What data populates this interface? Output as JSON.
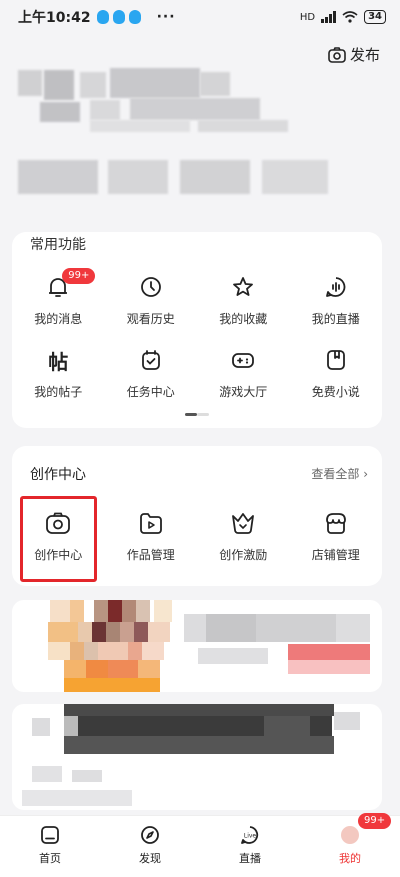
{
  "status_bar": {
    "time": "上午10:42",
    "battery": "34",
    "network": "HD"
  },
  "header": {
    "publish_label": "发布"
  },
  "common_functions": {
    "title": "常用功能",
    "items": [
      {
        "label": "我的消息",
        "icon": "bell-icon",
        "badge": "99+"
      },
      {
        "label": "观看历史",
        "icon": "clock-icon"
      },
      {
        "label": "我的收藏",
        "icon": "star-icon"
      },
      {
        "label": "我的直播",
        "icon": "live-icon"
      },
      {
        "label": "我的帖子",
        "icon": "post-icon"
      },
      {
        "label": "任务中心",
        "icon": "task-icon"
      },
      {
        "label": "游戏大厅",
        "icon": "gamepad-icon"
      },
      {
        "label": "免费小说",
        "icon": "book-icon"
      }
    ]
  },
  "creation_center": {
    "title": "创作中心",
    "view_all": "查看全部",
    "items": [
      {
        "label": "创作中心",
        "icon": "camera-icon"
      },
      {
        "label": "作品管理",
        "icon": "video-folder-icon"
      },
      {
        "label": "创作激励",
        "icon": "crown-icon"
      },
      {
        "label": "店铺管理",
        "icon": "shop-icon"
      }
    ]
  },
  "bottom_nav": {
    "items": [
      {
        "label": "首页",
        "icon": "home-icon"
      },
      {
        "label": "发现",
        "icon": "compass-icon"
      },
      {
        "label": "直播",
        "icon": "live-tv-icon"
      },
      {
        "label": "我的",
        "icon": "avatar",
        "badge": "99+"
      }
    ]
  },
  "colors": {
    "accent_red": "#f0383c",
    "highlight_box": "#e3262b",
    "background": "#f4f4f6"
  }
}
